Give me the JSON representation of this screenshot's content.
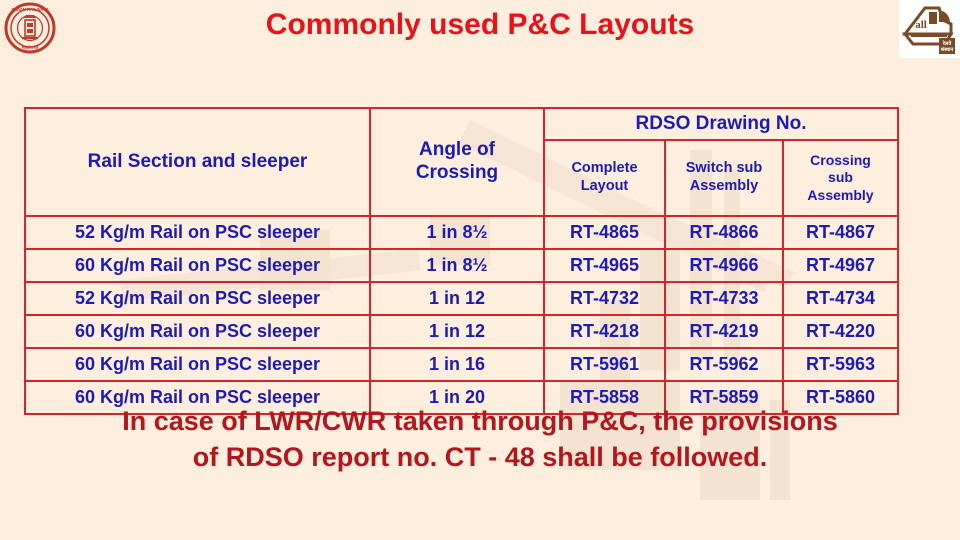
{
  "slide": {
    "title": "Commonly used P&C Layouts",
    "title_color": "#e8131a",
    "background_color": "#fdeedd",
    "table_border_color": "#d4252a",
    "table_text_color": "#1b1bb5",
    "note_color": "#b3161f"
  },
  "logos": {
    "left": {
      "name": "indian-railways-emblem",
      "color": "#c0392b"
    },
    "right": {
      "name": "iriset-locomotive-emblem",
      "color": "#7a4a25"
    }
  },
  "table": {
    "headers": {
      "rail_section": "Rail Section and sleeper",
      "angle_of_crossing": "Angle of Crossing",
      "angle_of_crossing_line1": "Angle of",
      "angle_of_crossing_line2": "Crossing",
      "rdso_group": "RDSO Drawing No.",
      "complete_layout": "Complete Layout",
      "complete_layout_line1": "Complete",
      "complete_layout_line2": "Layout",
      "switch_sub_assembly": "Switch sub Assembly",
      "switch_sub_assembly_line1": "Switch sub",
      "switch_sub_assembly_line2": "Assembly",
      "crossing_sub_assembly": "Crossing sub Assembly",
      "crossing_sub_assembly_line1": "Crossing",
      "crossing_sub_assembly_line2": "sub",
      "crossing_sub_assembly_line3": "Assembly"
    },
    "rows": [
      {
        "rail_section": "52 Kg/m Rail on PSC sleeper",
        "angle": "1 in 8½",
        "complete_layout": "RT-4865",
        "switch_sub_assembly": "RT-4866",
        "crossing_sub_assembly": "RT-4867"
      },
      {
        "rail_section": "60 Kg/m Rail on PSC sleeper",
        "angle": "1 in 8½",
        "complete_layout": "RT-4965",
        "switch_sub_assembly": "RT-4966",
        "crossing_sub_assembly": "RT-4967"
      },
      {
        "rail_section": "52 Kg/m Rail on PSC sleeper",
        "angle": "1 in 12",
        "complete_layout": "RT-4732",
        "switch_sub_assembly": "RT-4733",
        "crossing_sub_assembly": "RT-4734"
      },
      {
        "rail_section": "60 Kg/m Rail on PSC sleeper",
        "angle": "1 in 12",
        "complete_layout": "RT-4218",
        "switch_sub_assembly": "RT-4219",
        "crossing_sub_assembly": "RT-4220"
      },
      {
        "rail_section": "60 Kg/m Rail on PSC sleeper",
        "angle": "1 in 16",
        "complete_layout": "RT-5961",
        "switch_sub_assembly": "RT-5962",
        "crossing_sub_assembly": "RT-5963"
      },
      {
        "rail_section": "60 Kg/m Rail on PSC sleeper",
        "angle": "1 in 20",
        "complete_layout": "RT-5858",
        "switch_sub_assembly": "RT-5859",
        "crossing_sub_assembly": "RT-5860"
      }
    ]
  },
  "note": {
    "line1": "In case of LWR/CWR taken through P&C, the provisions",
    "line2": "of RDSO report no. CT - 48 shall be followed."
  }
}
